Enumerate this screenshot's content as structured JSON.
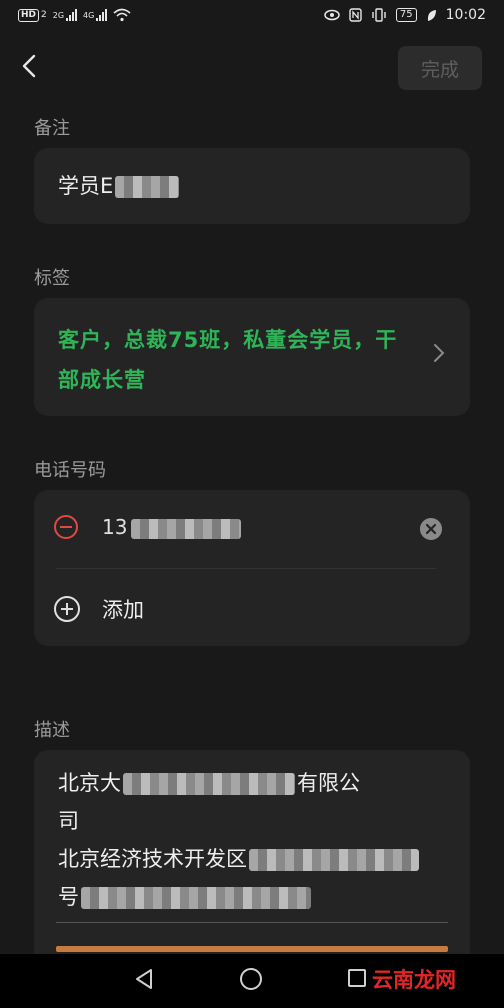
{
  "status_bar": {
    "hd_badge": "HD",
    "sim_index": "2",
    "network_a": "2G",
    "network_b": "4G",
    "battery": "75",
    "time": "10:02"
  },
  "top_bar": {
    "done_label": "完成"
  },
  "note": {
    "label": "备注",
    "value": "学员E"
  },
  "tags": {
    "label": "标签",
    "value": "客户，总裁75班，私董会学员，干部成长营",
    "color": "#2fb457"
  },
  "phone": {
    "label": "电话号码",
    "value": "13",
    "add_label": "添加"
  },
  "description": {
    "label": "描述",
    "line1": "北京大",
    "line1_end": "有限公",
    "line2": "司",
    "line3": "北京经济技术开发区",
    "line4": "号"
  },
  "watermark": "云南龙网",
  "colors": {
    "background": "#191919",
    "card": "#242424",
    "accent_green": "#2fb457",
    "remove_red": "#e04a44"
  },
  "icons": [
    "back-arrow-icon",
    "chevron-right-icon",
    "remove-circle-icon",
    "clear-icon",
    "add-circle-icon",
    "nav-back-icon",
    "nav-home-icon",
    "nav-recent-icon"
  ]
}
